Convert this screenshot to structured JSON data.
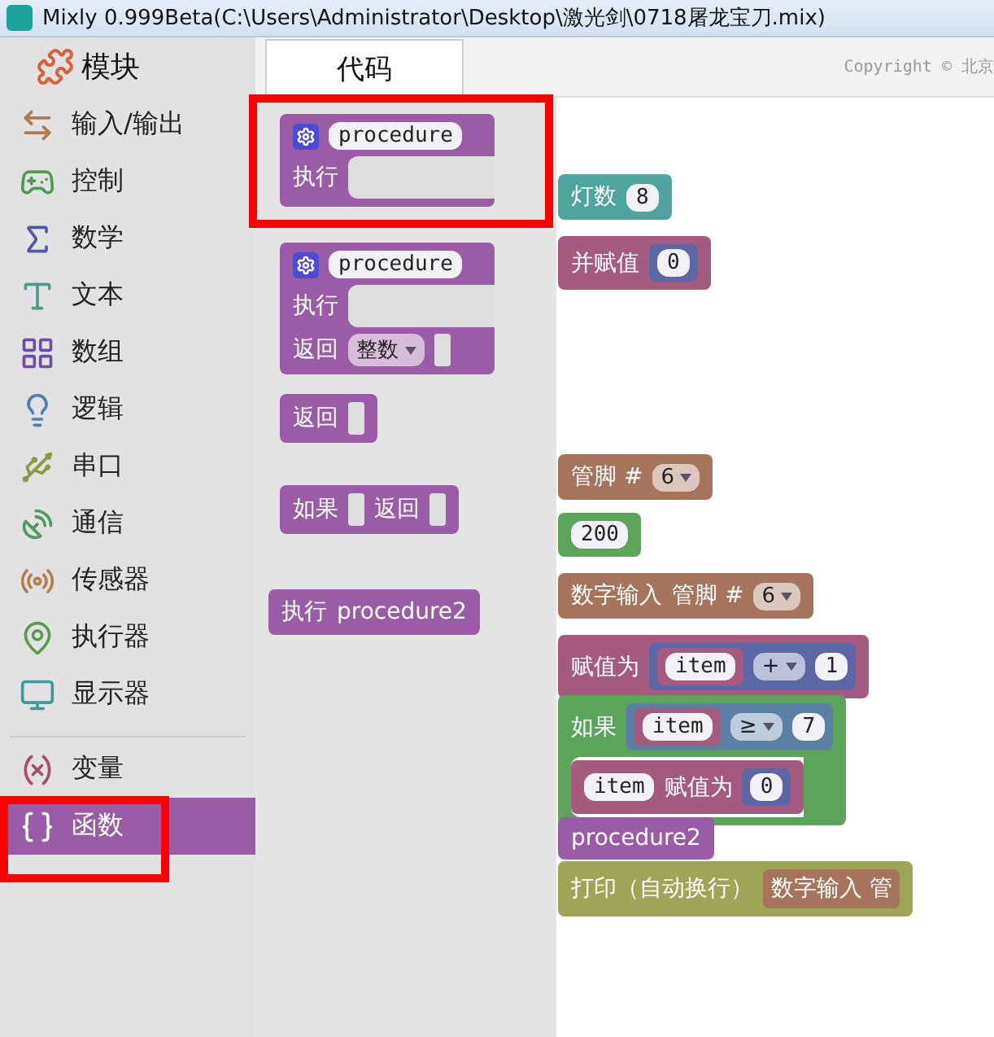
{
  "window": {
    "title": "Mixly 0.999Beta(C:\\Users\\Administrator\\Desktop\\激光剑\\0718屠龙宝刀.mix)"
  },
  "sidebar": {
    "title": "模块",
    "groups": [
      [
        {
          "label": "输入/输出",
          "selected": false
        },
        {
          "label": "控制",
          "selected": false
        },
        {
          "label": "数学",
          "selected": false
        },
        {
          "label": "文本",
          "selected": false
        },
        {
          "label": "数组",
          "selected": false
        },
        {
          "label": "逻辑",
          "selected": false
        },
        {
          "label": "串口",
          "selected": false
        },
        {
          "label": "通信",
          "selected": false
        },
        {
          "label": "传感器",
          "selected": false
        },
        {
          "label": "执行器",
          "selected": false
        },
        {
          "label": "显示器",
          "selected": false
        }
      ],
      [
        {
          "label": "变量",
          "selected": false
        },
        {
          "label": "函数",
          "selected": true
        }
      ]
    ]
  },
  "tabs": [
    {
      "label": "代码",
      "selected": true
    }
  ],
  "copyright": "Copyright © 北京",
  "workspace": {
    "blocks": [
      {
        "kind": "loop",
        "lines": [
          [
            {
              "kind": "text",
              "text": "灯数"
            },
            {
              "kind": "field",
              "text": "8"
            }
          ]
        ]
      },
      {
        "kind": "variable",
        "lines": [
          [
            {
              "kind": "text",
              "text": "并赋值"
            },
            {
              "kind": "block",
              "block": {
                "kind": "math",
                "lines": [
                  [
                    {
                      "kind": "field",
                      "text": "0"
                    }
                  ]
                ]
              }
            }
          ]
        ]
      },
      {
        "kind": "io",
        "lines": [
          [
            {
              "kind": "text",
              "text": "管脚 #"
            },
            {
              "kind": "dropdown",
              "text": "6"
            }
          ]
        ]
      },
      {
        "kind": "time",
        "lines": [
          [
            {
              "kind": "field",
              "text": "200"
            }
          ]
        ]
      },
      {
        "kind": "io",
        "lines": [
          [
            {
              "kind": "text",
              "text": "数字输入"
            },
            {
              "kind": "text",
              "text": "管脚 #"
            },
            {
              "kind": "dropdown",
              "text": "6"
            }
          ]
        ]
      },
      {
        "kind": "variable",
        "lines": [
          [
            {
              "kind": "text",
              "text": "赋值为"
            },
            {
              "kind": "block",
              "block": {
                "kind": "math",
                "lines": [
                  [
                    {
                      "kind": "block",
                      "block": {
                        "kind": "variable",
                        "lines": [
                          [
                            {
                              "kind": "field",
                              "text": "item"
                            }
                          ]
                        ]
                      }
                    },
                    {
                      "kind": "dropdown",
                      "text": "+"
                    },
                    {
                      "kind": "field",
                      "text": "1"
                    }
                  ]
                ]
              }
            }
          ]
        ]
      },
      {
        "kind": "control",
        "lines": [
          [
            {
              "kind": "text",
              "text": "如果"
            },
            {
              "kind": "block",
              "block": {
                "kind": "logic",
                "lines": [
                  [
                    {
                      "kind": "block",
                      "block": {
                        "kind": "variable",
                        "lines": [
                          [
                            {
                              "kind": "field",
                              "text": "item"
                            }
                          ]
                        ]
                      }
                    },
                    {
                      "kind": "dropdown",
                      "text": "≥"
                    },
                    {
                      "kind": "field",
                      "text": "7"
                    }
                  ]
                ]
              }
            }
          ],
          [
            {
              "kind": "statement",
              "blocks": [
                {
                  "kind": "variable",
                  "lines": [
                    [
                      {
                        "kind": "field",
                        "text": "item"
                      },
                      {
                        "kind": "text",
                        "text": "赋值为"
                      },
                      {
                        "kind": "block",
                        "block": {
                          "kind": "math",
                          "lines": [
                            [
                              {
                                "kind": "field",
                                "text": "0"
                              }
                            ]
                          ]
                        }
                      }
                    ]
                  ]
                }
              ]
            }
          ]
        ]
      },
      {
        "kind": "procedure",
        "lines": [
          [
            {
              "kind": "text",
              "text": "procedure2"
            }
          ]
        ]
      },
      {
        "kind": "serial",
        "lines": [
          [
            {
              "kind": "text",
              "text": "打印（自动换行）"
            },
            {
              "kind": "block",
              "block": {
                "kind": "io",
                "lines": [
                  [
                    {
                      "kind": "text",
                      "text": "数字输入 管"
                    }
                  ]
                ]
              }
            }
          ]
        ]
      }
    ]
  },
  "flyout": {
    "blocks": [
      {
        "kind": "procedure",
        "lines": [
          [
            {
              "kind": "gear"
            },
            {
              "kind": "field",
              "text": "procedure"
            }
          ],
          [
            {
              "kind": "text",
              "text": "执行"
            },
            {
              "kind": "statement"
            }
          ]
        ]
      },
      {
        "kind": "procedure",
        "lines": [
          [
            {
              "kind": "gear"
            },
            {
              "kind": "field",
              "text": "procedure"
            }
          ],
          [
            {
              "kind": "text",
              "text": "执行"
            },
            {
              "kind": "statement"
            }
          ],
          [
            {
              "kind": "text",
              "text": "返回"
            },
            {
              "kind": "dropdown",
              "text": "整数"
            },
            {
              "kind": "socket"
            }
          ]
        ]
      },
      {
        "kind": "procedure",
        "lines": [
          [
            {
              "kind": "text",
              "text": "返回"
            },
            {
              "kind": "socket"
            }
          ]
        ]
      },
      {
        "kind": "procedure",
        "lines": [
          [
            {
              "kind": "text",
              "text": "如果"
            },
            {
              "kind": "socket"
            },
            {
              "kind": "text",
              "text": "返回"
            },
            {
              "kind": "socket"
            }
          ]
        ]
      },
      {
        "kind": "procedure",
        "lines": [
          [
            {
              "kind": "text",
              "text": "执行"
            },
            {
              "kind": "text",
              "text": "procedure2"
            }
          ]
        ]
      }
    ]
  },
  "annotations": [
    {
      "kind": "highlight"
    },
    {
      "kind": "highlight"
    }
  ]
}
